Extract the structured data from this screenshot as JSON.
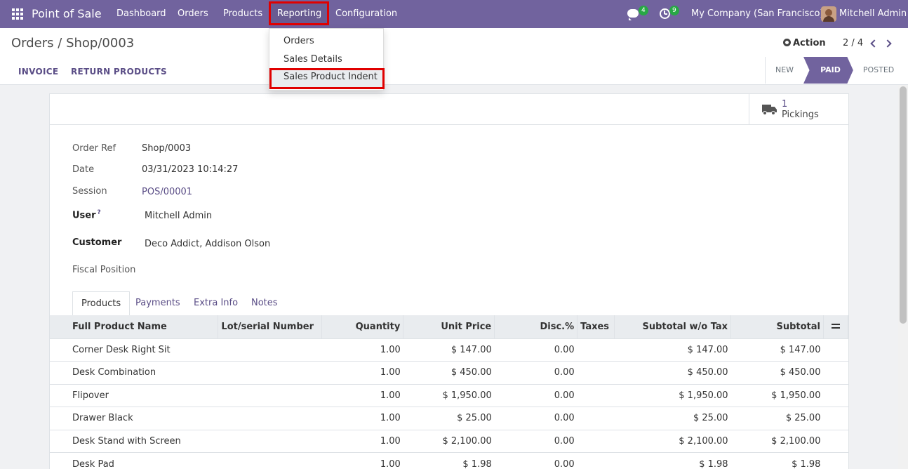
{
  "navbar": {
    "brand": "Point of Sale",
    "menus": [
      "Dashboard",
      "Orders",
      "Products",
      "Reporting",
      "Configuration"
    ],
    "chat_count": "4",
    "activity_count": "9",
    "company": "My Company (San Francisco)",
    "user": "Mitchell Admin"
  },
  "reporting_menu": {
    "items": [
      "Orders",
      "Sales Details",
      "Sales Product Indent"
    ]
  },
  "control": {
    "breadcrumb_parent": "Orders",
    "breadcrumb_sep": "/",
    "breadcrumb_current": "Shop/0003",
    "action_label": "Action",
    "pager": "2 / 4",
    "buttons": [
      "INVOICE",
      "RETURN PRODUCTS"
    ],
    "statuses": [
      "NEW",
      "PAID",
      "POSTED"
    ],
    "active_status": "PAID"
  },
  "smart_button": {
    "count": "1",
    "label": "Pickings"
  },
  "fields": {
    "order_ref_label": "Order Ref",
    "order_ref": "Shop/0003",
    "date_label": "Date",
    "date": "03/31/2023 10:14:27",
    "session_label": "Session",
    "session": "POS/00001",
    "user_label": "User",
    "user_help": "?",
    "user": "Mitchell Admin",
    "customer_label": "Customer",
    "customer": "Deco Addict, Addison Olson",
    "fiscal_label": "Fiscal Position"
  },
  "tabs": [
    "Products",
    "Payments",
    "Extra Info",
    "Notes"
  ],
  "table": {
    "headers": [
      "Full Product Name",
      "Lot/serial Number",
      "Quantity",
      "Unit Price",
      "Disc.%",
      "Taxes",
      "Subtotal w/o Tax",
      "Subtotal"
    ],
    "rows": [
      [
        "Corner Desk Right Sit",
        "",
        "1.00",
        "$ 147.00",
        "0.00",
        "",
        "$ 147.00",
        "$ 147.00"
      ],
      [
        "Desk Combination",
        "",
        "1.00",
        "$ 450.00",
        "0.00",
        "",
        "$ 450.00",
        "$ 450.00"
      ],
      [
        "Flipover",
        "",
        "1.00",
        "$ 1,950.00",
        "0.00",
        "",
        "$ 1,950.00",
        "$ 1,950.00"
      ],
      [
        "Drawer Black",
        "",
        "1.00",
        "$ 25.00",
        "0.00",
        "",
        "$ 25.00",
        "$ 25.00"
      ],
      [
        "Desk Stand with Screen",
        "",
        "1.00",
        "$ 2,100.00",
        "0.00",
        "",
        "$ 2,100.00",
        "$ 2,100.00"
      ],
      [
        "Desk Pad",
        "",
        "1.00",
        "$ 1.98",
        "0.00",
        "",
        "$ 1.98",
        "$ 1.98"
      ]
    ]
  },
  "colors": {
    "brand": "#71639e",
    "link": "#5a4d86",
    "highlight_border": "#e00000"
  }
}
